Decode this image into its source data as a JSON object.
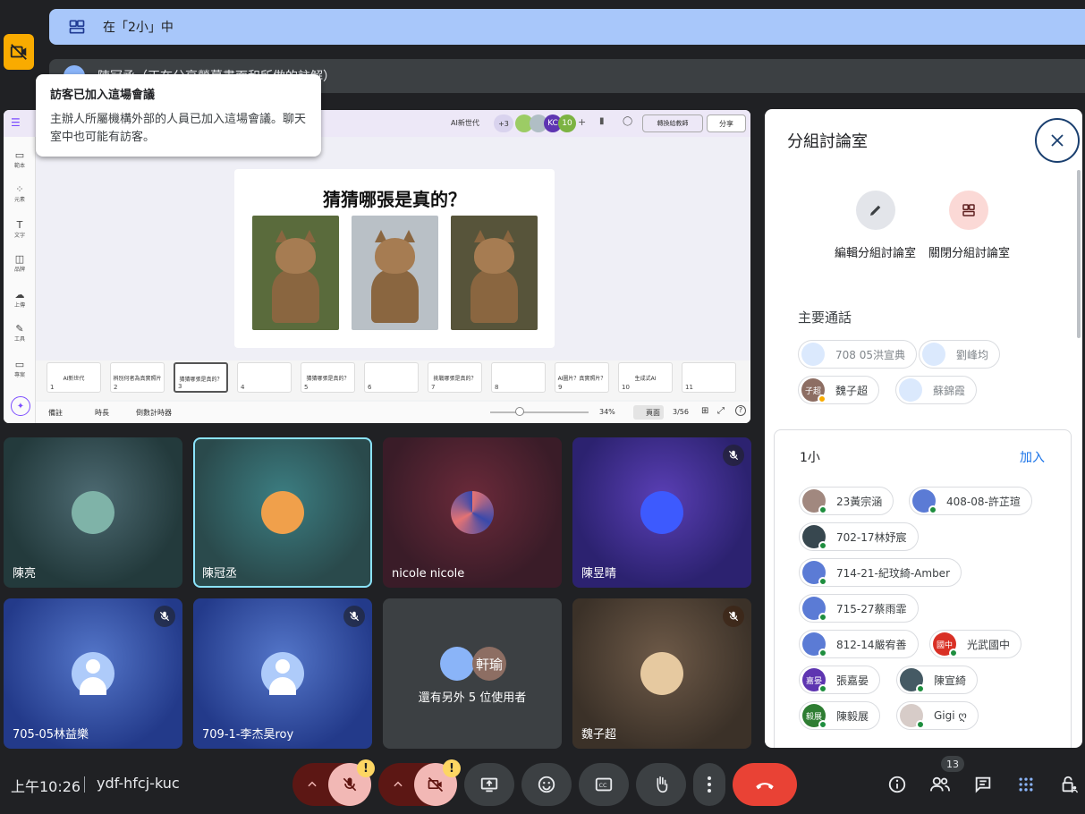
{
  "room_banner": {
    "text": "在「2小」中"
  },
  "presenter_banner": {
    "text": "陳冠丞（正在分享螢幕畫面和所做的註解）"
  },
  "visitor_tip": {
    "title": "訪客已加入這場會議",
    "body": "主辦人所屬機構外部的人員已加入這場會議。聊天室中也可能有訪客。"
  },
  "screen": {
    "topbar": {
      "doc_label": "AI新世代",
      "collab_more": "+3",
      "collab_initials": "KC",
      "collab_count": "10",
      "present_label": "轉換給教師",
      "share_label": "分享"
    },
    "leftbar": [
      "範本",
      "元素",
      "文字",
      "品牌",
      "上傳",
      "工具",
      "專案"
    ],
    "slide_title": "猜猜哪張是真的？",
    "thumbnails": [
      {
        "num": "1",
        "label": "AI新世代"
      },
      {
        "num": "2",
        "label": "辨別何者為真實照片"
      },
      {
        "num": "3",
        "label": "猜猜哪張是真的？"
      },
      {
        "num": "4",
        "label": ""
      },
      {
        "num": "5",
        "label": "猜猜哪張是真的？"
      },
      {
        "num": "6",
        "label": ""
      },
      {
        "num": "7",
        "label": "挑戰哪張是真的？"
      },
      {
        "num": "8",
        "label": ""
      },
      {
        "num": "9",
        "label": "AI圖片？真實照片？"
      },
      {
        "num": "10",
        "label": "生成式AI"
      },
      {
        "num": "11",
        "label": ""
      }
    ],
    "status": {
      "notes": "備註",
      "duration": "時長",
      "timer": "倒數計時器",
      "zoom": "34%",
      "view": "頁面",
      "page": "3/56"
    }
  },
  "tiles": [
    {
      "name": "陳亮",
      "muted": false
    },
    {
      "name": "陳冠丞",
      "muted": false
    },
    {
      "name": "nicole nicole",
      "muted": false
    },
    {
      "name": "陳昱晴",
      "muted": true
    },
    {
      "name": "705-05林益樂",
      "muted": true
    },
    {
      "name": "709-1-李杰昊roy",
      "muted": true
    },
    {
      "name": "還有另外 5 位使用者",
      "avatar_text": "軒瑜",
      "muted": false
    },
    {
      "name": "魏子超",
      "muted": true
    }
  ],
  "panel": {
    "title": "分組討論室",
    "edit_label": "編輯分組討論室",
    "close_rooms_label": "關閉分組討論室",
    "main_call_title": "主要通話",
    "main_call_members": [
      {
        "name": "708 05洪宣典",
        "dim": true
      },
      {
        "name": "劉峰均",
        "dim": true
      },
      {
        "name": "魏子超",
        "initials": "子超",
        "dim": false
      },
      {
        "name": "蘇錦霞",
        "dim": true
      }
    ],
    "room1": {
      "title": "1小",
      "join_label": "加入",
      "members": [
        {
          "name": "23黃宗涵"
        },
        {
          "name": "408-08-許芷瑄"
        },
        {
          "name": "702-17林妤宸"
        },
        {
          "name": "714-21-紀玟綺-Amber"
        },
        {
          "name": "715-27蔡雨霏"
        },
        {
          "name": "812-14嚴宥善"
        },
        {
          "name": "光武國中",
          "initials": "國中"
        },
        {
          "name": "張嘉晏",
          "initials": "嘉晏"
        },
        {
          "name": "陳宣綺"
        },
        {
          "name": "陳毅展",
          "initials": "毅展"
        },
        {
          "name": "Gigi ღ"
        }
      ]
    }
  },
  "bottom": {
    "time": "上午10:26",
    "code": "ydf-hfcj-kuc",
    "people_count": "13",
    "warn": "!"
  },
  "colors": {
    "accent": "#a8c7fa",
    "end_call": "#e94235",
    "muted_red": "#f2b8b5",
    "online_dot": "#1e8e3e"
  }
}
